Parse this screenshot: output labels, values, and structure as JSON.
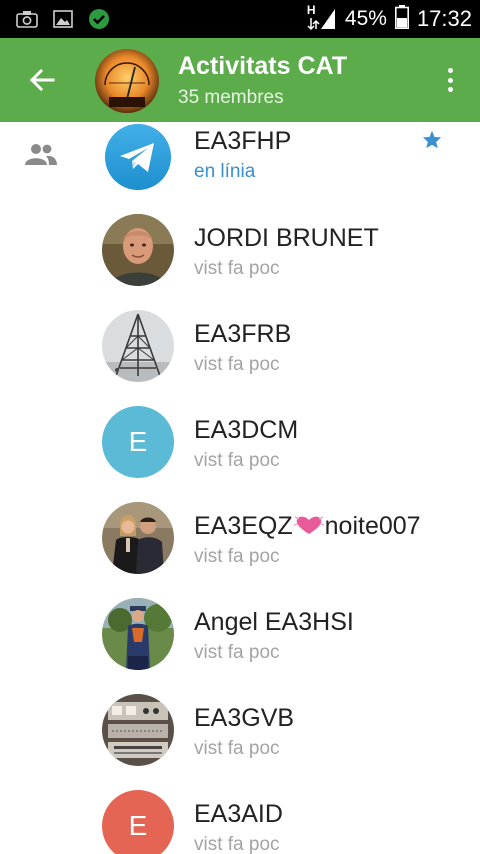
{
  "statusbar": {
    "network_label": "H",
    "battery": "45%",
    "time": "17:32",
    "icons": [
      "screenshot-icon",
      "gallery-icon",
      "check-icon",
      "signal-icon",
      "battery-icon"
    ]
  },
  "header": {
    "title": "Activitats CAT",
    "subtitle": "35 membres",
    "color": "#5cac4b"
  },
  "members": [
    {
      "name": "EA3FHP",
      "status": "en línia",
      "online": true,
      "admin": true,
      "avatar": "telegram-logo"
    },
    {
      "name": "JORDI BRUNET",
      "status": "vist fa poc",
      "avatar": "photo-man-portrait"
    },
    {
      "name": "EA3FRB",
      "status": "vist fa poc",
      "avatar": "photo-antenna-tower"
    },
    {
      "name": "EA3DCM",
      "status": "vist fa poc",
      "avatar_letter": "E",
      "avatar_color": "#5bbad5"
    },
    {
      "name_prefix": "EA3EQZ",
      "name_suffix": "noite007",
      "status": "vist fa poc",
      "avatar": "photo-couple"
    },
    {
      "name": "Angel EA3HSI",
      "status": "vist fa poc",
      "avatar": "photo-man-outdoors"
    },
    {
      "name": "EA3GVB",
      "status": "vist fa poc",
      "avatar": "photo-radio-equipment"
    },
    {
      "name": "EA3AID",
      "status": "vist fa poc",
      "avatar_letter": "E",
      "avatar_color": "#e56555"
    }
  ]
}
